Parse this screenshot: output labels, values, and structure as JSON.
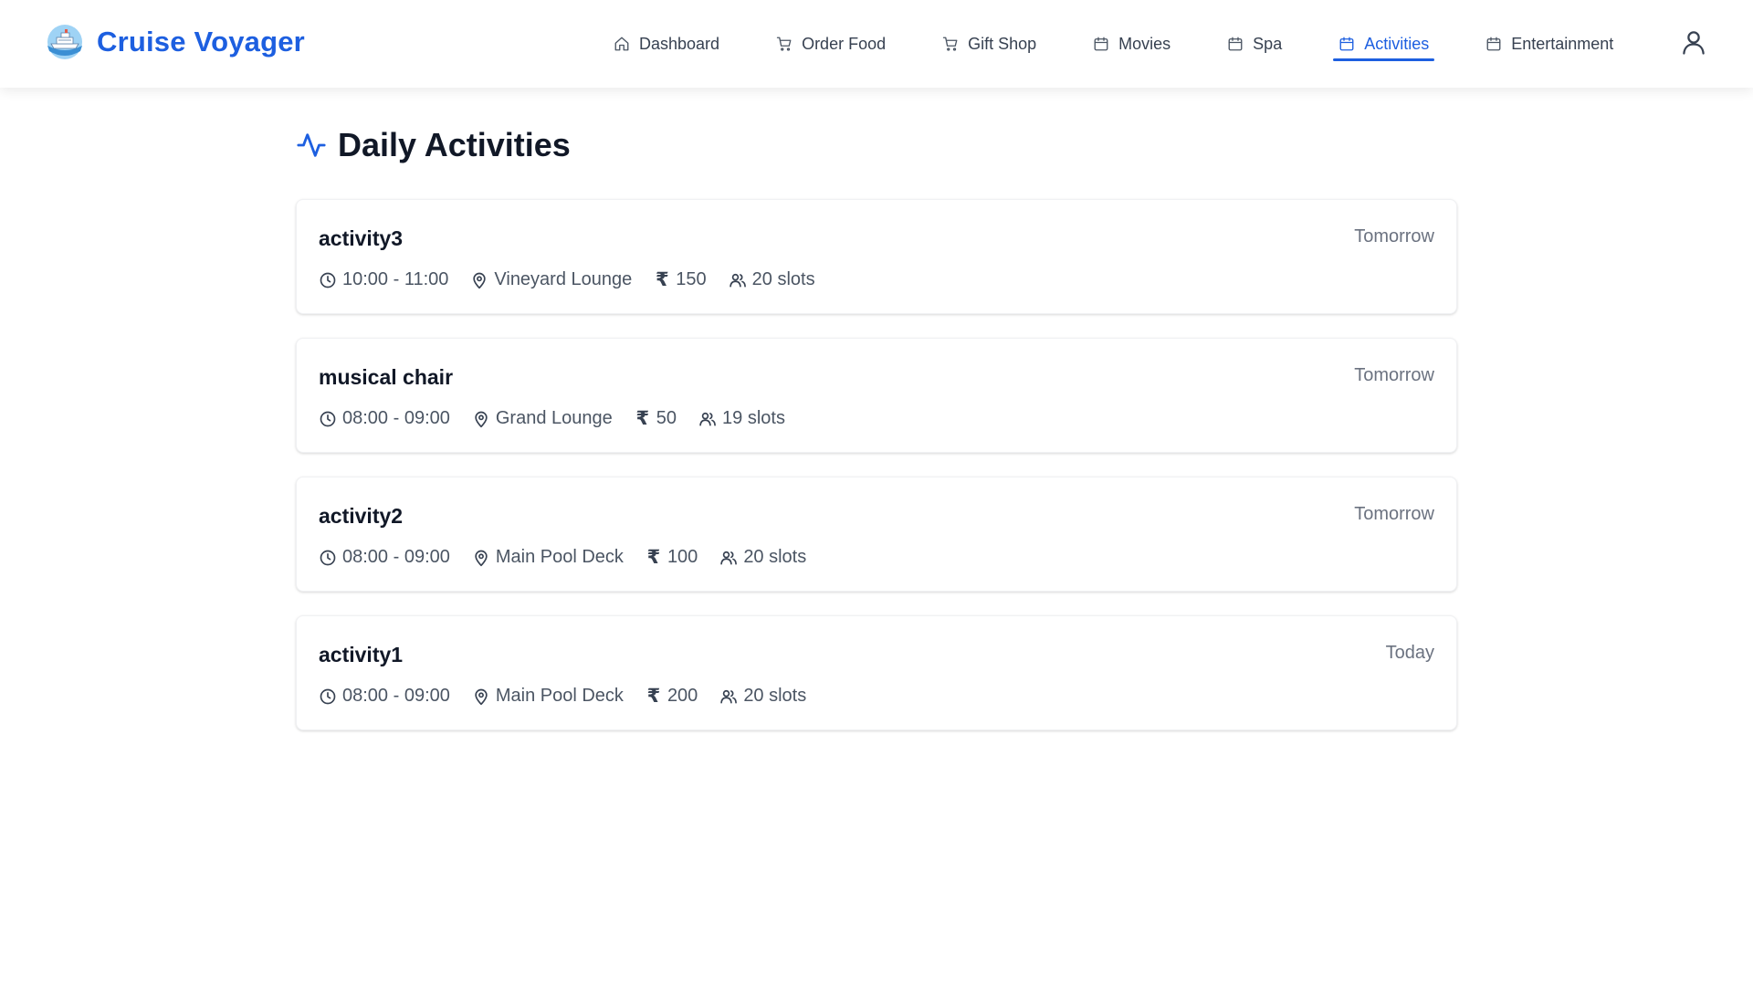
{
  "brand": {
    "name": "Cruise Voyager",
    "logo_icon": "cruise-ship-icon"
  },
  "nav": {
    "items": [
      {
        "label": "Dashboard",
        "icon": "home-icon"
      },
      {
        "label": "Order Food",
        "icon": "cart-icon"
      },
      {
        "label": "Gift Shop",
        "icon": "cart-icon"
      },
      {
        "label": "Movies",
        "icon": "calendar-icon"
      },
      {
        "label": "Spa",
        "icon": "calendar-icon"
      },
      {
        "label": "Activities",
        "icon": "calendar-icon",
        "active": true
      },
      {
        "label": "Entertainment",
        "icon": "calendar-icon"
      }
    ],
    "user_icon": "user-icon"
  },
  "page": {
    "title": "Daily Activities",
    "title_icon": "activity-pulse-icon"
  },
  "activities": [
    {
      "name": "activity3",
      "day": "Tomorrow",
      "time": "10:00 - 11:00",
      "location": "Vineyard Lounge",
      "currency": "₹",
      "price": "150",
      "slots": "20 slots"
    },
    {
      "name": "musical chair",
      "day": "Tomorrow",
      "time": "08:00 - 09:00",
      "location": "Grand Lounge",
      "currency": "₹",
      "price": "50",
      "slots": "19 slots"
    },
    {
      "name": "activity2",
      "day": "Tomorrow",
      "time": "08:00 - 09:00",
      "location": "Main Pool Deck",
      "currency": "₹",
      "price": "100",
      "slots": "20 slots"
    },
    {
      "name": "activity1",
      "day": "Today",
      "time": "08:00 - 09:00",
      "location": "Main Pool Deck",
      "currency": "₹",
      "price": "200",
      "slots": "20 slots"
    }
  ],
  "colors": {
    "accent": "#1d5fe0",
    "text": "#1f2937",
    "muted": "#6b7280"
  }
}
